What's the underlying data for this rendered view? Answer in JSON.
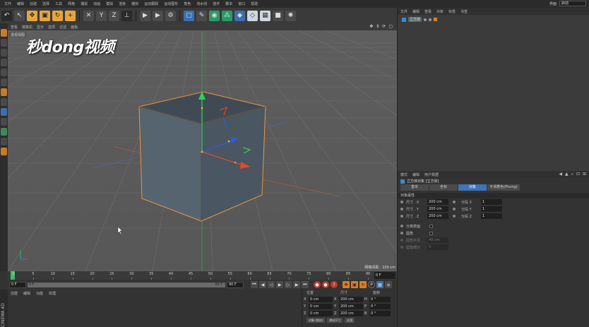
{
  "menubar": {
    "items": [
      "文件",
      "编辑",
      "创建",
      "选择",
      "工具",
      "网格",
      "捕捉",
      "动画",
      "模拟",
      "渲染",
      "雕刻",
      "运动跟踪",
      "运动图形",
      "角色",
      "流水线",
      "插件",
      "脚本",
      "窗口",
      "帮助"
    ],
    "layout_label": "界面",
    "layout_value": "启动"
  },
  "toolbar": {
    "icons": [
      "undo-icon",
      "live-select-icon",
      "move-icon",
      "scale-icon",
      "rotate-icon",
      "add-object-icon",
      "x-axis-icon",
      "y-axis-icon",
      "z-axis-icon",
      "coordinate-system-icon",
      "render-view-icon",
      "render-picture-icon",
      "render-settings-icon",
      "cube-icon",
      "pen-icon",
      "subdivision-icon",
      "array-icon",
      "deformer-icon",
      "field-icon",
      "scene-icon",
      "camera-icon",
      "light-icon"
    ]
  },
  "watermark": "秒dong视频",
  "viewport": {
    "menu": [
      "查看",
      "摄像机",
      "显示",
      "选项",
      "过滤",
      "面板"
    ],
    "camera_label": "透视视图",
    "grid_spacing": "网格间距 : 100 cm"
  },
  "timeline": {
    "ticks": [
      "0",
      "5",
      "10",
      "15",
      "20",
      "25",
      "30",
      "35",
      "40",
      "45",
      "50",
      "55",
      "60",
      "65",
      "70",
      "75",
      "80",
      "85",
      "90"
    ],
    "end_frame": "0 F"
  },
  "transport": {
    "start_field": "0 F",
    "slider_start": "0 F",
    "slider_end": "90 F",
    "end_field": "90 F"
  },
  "material_manager": {
    "menu": [
      "创建",
      "编辑",
      "功能",
      "纹理"
    ]
  },
  "app_logo_text": "CINEMA 4D",
  "coordinates": {
    "headers": [
      "位置",
      "尺寸",
      "旋转"
    ],
    "rows": [
      {
        "axis": "X",
        "pos": "0 cm",
        "size_axis": "X",
        "size": "200 cm",
        "rot_axis": "H",
        "rot": "0 °"
      },
      {
        "axis": "Y",
        "pos": "0 cm",
        "size_axis": "Y",
        "size": "200 cm",
        "rot_axis": "P",
        "rot": "0 °"
      },
      {
        "axis": "Z",
        "pos": "0 cm",
        "size_axis": "Z",
        "size": "200 cm",
        "rot_axis": "B",
        "rot": "0 °"
      }
    ],
    "mode_select": "对象 (相对)",
    "size_select": "绝对尺寸",
    "apply_button": "应用"
  },
  "object_manager": {
    "menu": [
      "文件",
      "编辑",
      "查看",
      "对象",
      "标签",
      "书签"
    ],
    "objects": [
      {
        "name": "立方体"
      }
    ]
  },
  "attributes": {
    "menu": [
      "模式",
      "编辑",
      "用户数据"
    ],
    "title": "立方体对象 [立方体]",
    "tabs": [
      "基本",
      "坐标",
      "对象",
      "平滑着色(Phong)"
    ],
    "active_tab_index": 2,
    "section": "对象属性",
    "params": [
      {
        "label": "尺寸 . X",
        "value": "200 cm",
        "label2": "分段 X",
        "value2": "1"
      },
      {
        "label": "尺寸 . Y",
        "value": "200 cm",
        "label2": "分段 Y",
        "value2": "1"
      },
      {
        "label": "尺寸 . Z",
        "value": "200 cm",
        "label2": "分段 Z",
        "value2": "1"
      }
    ],
    "separate_surfaces": "分离表面",
    "fillet": "圆角",
    "fillet_radius_label": "圆角半径",
    "fillet_radius_value": "40 cm",
    "fillet_subdiv_label": "圆角细分",
    "fillet_subdiv_value": "5"
  },
  "colors": {
    "selection_outline": "#e8963c",
    "x_axis": "#e04a2a",
    "y_axis": "#2fcf5a",
    "z_axis": "#2a5ee0",
    "active_tab": "#3e74b8"
  }
}
